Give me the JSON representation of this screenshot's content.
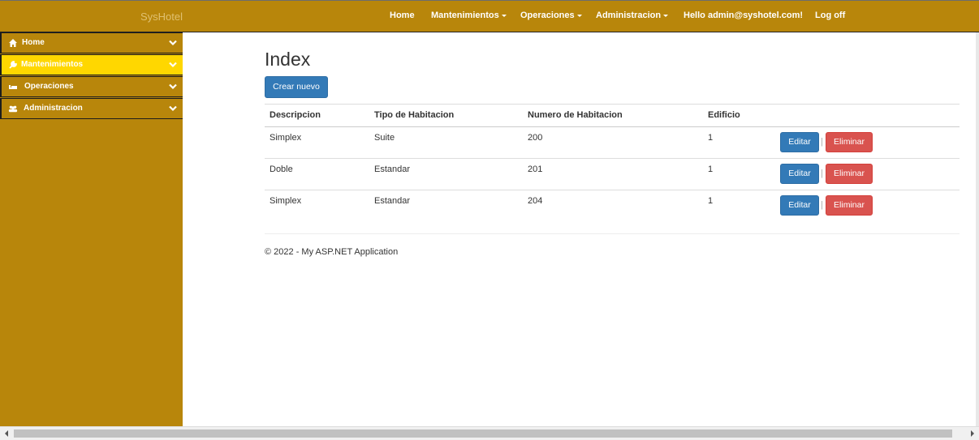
{
  "brand": "SysHotel",
  "nav": {
    "home": "Home",
    "mantenimientos": "Mantenimientos",
    "operaciones": "Operaciones",
    "administracion": "Administracion",
    "hello": "Hello admin@syshotel.com!",
    "logoff": "Log off"
  },
  "sidebar": {
    "items": [
      {
        "label": "Home",
        "icon": "home-icon"
      },
      {
        "label": "Mantenimientos",
        "icon": "wrench-icon"
      },
      {
        "label": "Operaciones",
        "icon": "bed-icon"
      },
      {
        "label": "Administracion",
        "icon": "users-icon"
      }
    ]
  },
  "page": {
    "title": "Index",
    "create_label": "Crear nuevo"
  },
  "table": {
    "headers": [
      "Descripcion",
      "Tipo de Habitacion",
      "Numero de Habitacion",
      "Edificio"
    ],
    "rows": [
      [
        "Simplex",
        "Suite",
        "200",
        "1"
      ],
      [
        "Doble",
        "Estandar",
        "201",
        "1"
      ],
      [
        "Simplex",
        "Estandar",
        "204",
        "1"
      ]
    ],
    "edit_label": "Editar",
    "delete_label": "Eliminar",
    "separator": "|"
  },
  "footer": "© 2022 - My ASP.NET Application",
  "colors": {
    "brand_gold": "#b8860b",
    "active_yellow": "#ffd700",
    "primary": "#337ab7",
    "danger": "#d9534f"
  }
}
